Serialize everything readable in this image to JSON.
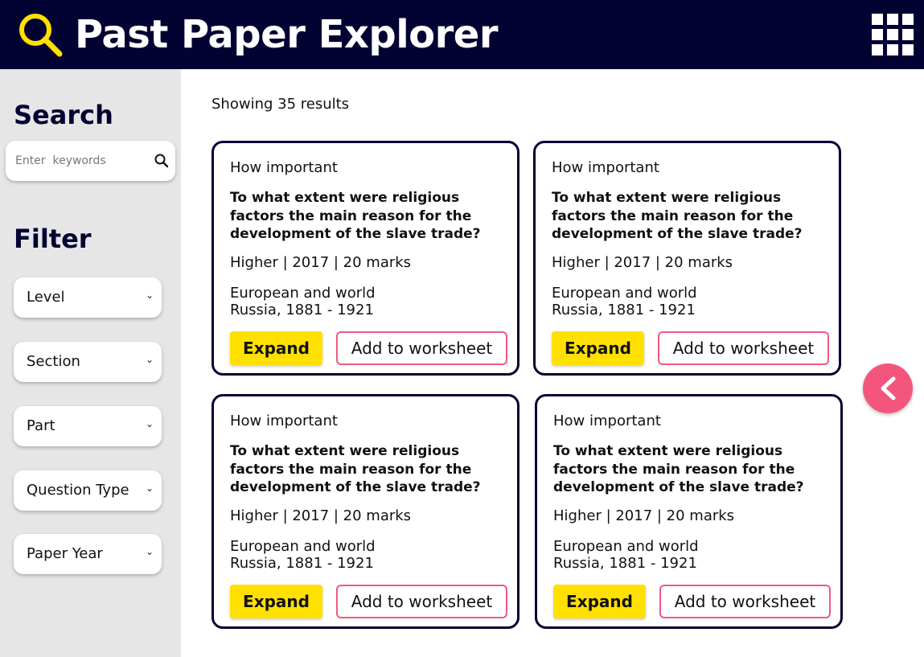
{
  "header": {
    "title": "Past Paper Explorer",
    "logo_icon": "magnifier-icon",
    "menu_icon": "grid-menu-icon",
    "background_color": "#020233",
    "accent_color": "#ffe000"
  },
  "sidebar": {
    "search_heading": "Search",
    "search_placeholder": "Enter  keywords",
    "search_icon": "search-icon",
    "filter_heading": "Filter",
    "filters": [
      {
        "label": "Level"
      },
      {
        "label": "Section"
      },
      {
        "label": "Part"
      },
      {
        "label": "Question Type"
      },
      {
        "label": "Paper Year"
      }
    ]
  },
  "main": {
    "results_text": "Showing 35 results",
    "cards": [
      {
        "type": "How important",
        "question": "To what extent were religious factors the main reason for the development of the slave trade?",
        "meta": "Higher | 2017 | 20 marks",
        "topic_line1": "European and world",
        "topic_line2": "Russia, 1881 - 1921",
        "expand_label": "Expand",
        "add_label": "Add to worksheet"
      },
      {
        "type": "How important",
        "question": "To what extent were religious factors the main reason for the development of the slave trade?",
        "meta": "Higher | 2017 | 20 marks",
        "topic_line1": "European and world",
        "topic_line2": "Russia, 1881 - 1921",
        "expand_label": "Expand",
        "add_label": "Add to worksheet"
      },
      {
        "type": "How important",
        "question": "To what extent were religious factors the main reason for the development of the slave trade?",
        "meta": "Higher | 2017 | 20 marks",
        "topic_line1": "European and world",
        "topic_line2": "Russia, 1881 - 1921",
        "expand_label": "Expand",
        "add_label": "Add to worksheet"
      },
      {
        "type": "How important",
        "question": "To what extent were religious factors the main reason for the development of the slave trade?",
        "meta": "Higher | 2017 | 20 marks",
        "topic_line1": "European and world",
        "topic_line2": "Russia, 1881 - 1921",
        "expand_label": "Expand",
        "add_label": "Add to worksheet"
      }
    ]
  },
  "fab": {
    "icon": "chevron-left-icon",
    "color": "#f4557c"
  }
}
